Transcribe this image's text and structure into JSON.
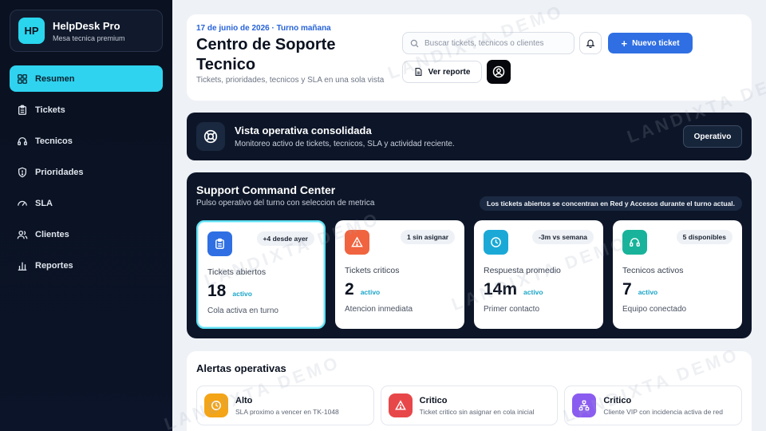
{
  "brand": {
    "logo": "HP",
    "name": "HelpDesk Pro",
    "subtitle": "Mesa tecnica premium"
  },
  "nav": [
    {
      "label": "Resumen",
      "icon": "grid-icon",
      "active": true
    },
    {
      "label": "Tickets",
      "icon": "clipboard-icon"
    },
    {
      "label": "Tecnicos",
      "icon": "headset-icon"
    },
    {
      "label": "Prioridades",
      "icon": "shield-icon"
    },
    {
      "label": "SLA",
      "icon": "gauge-icon"
    },
    {
      "label": "Clientes",
      "icon": "users-icon"
    },
    {
      "label": "Reportes",
      "icon": "bar-chart-icon"
    }
  ],
  "header": {
    "date": "17 de junio de 2026 · Turno mañana",
    "title": "Centro de Soporte Tecnico",
    "subtitle": "Tickets, prioridades, tecnicos y SLA en una sola vista",
    "search_placeholder": "Buscar tickets, tecnicos o clientes",
    "new_ticket_label": "Nuevo ticket",
    "report_label": "Ver reporte"
  },
  "banner": {
    "title": "Vista operativa consolidada",
    "subtitle": "Monitoreo activo de tickets, tecnicos, SLA y actividad reciente.",
    "status_label": "Operativo"
  },
  "command": {
    "title": "Support Command Center",
    "subtitle": "Pulso operativo del turno con seleccion de metrica",
    "insight": "Los tickets abiertos se concentran en Red y Accesos durante el turno actual.",
    "cards": [
      {
        "label": "Tickets abiertos",
        "value": "18",
        "status": "activo",
        "badge": "+4 desde ayer",
        "foot": "Cola activa en turno",
        "color": "#2f6fe3",
        "icon": "clipboard-icon",
        "selected": true
      },
      {
        "label": "Tickets criticos",
        "value": "2",
        "status": "activo",
        "badge": "1 sin asignar",
        "foot": "Atencion inmediata",
        "color": "#f0643f",
        "icon": "warning-icon"
      },
      {
        "label": "Respuesta promedio",
        "value": "14m",
        "status": "activo",
        "badge": "-3m vs semana",
        "foot": "Primer contacto",
        "color": "#1aa9d6",
        "icon": "clock-icon"
      },
      {
        "label": "Tecnicos activos",
        "value": "7",
        "status": "activo",
        "badge": "5 disponibles",
        "foot": "Equipo conectado",
        "color": "#18b39a",
        "icon": "headset-icon"
      }
    ]
  },
  "alerts": {
    "title": "Alertas operativas",
    "items": [
      {
        "level": "Alto",
        "desc": "SLA proximo a vencer en TK-1048",
        "color": "#f4a417",
        "icon": "clock-icon"
      },
      {
        "level": "Critico",
        "desc": "Ticket critico sin asignar en cola inicial",
        "color": "#e8474a",
        "icon": "warning-icon"
      },
      {
        "level": "Critico",
        "desc": "Cliente VIP con incidencia activa de red",
        "color": "#8b5cf0",
        "icon": "network-icon"
      }
    ]
  },
  "watermark": "LANDIXTA DEMO"
}
